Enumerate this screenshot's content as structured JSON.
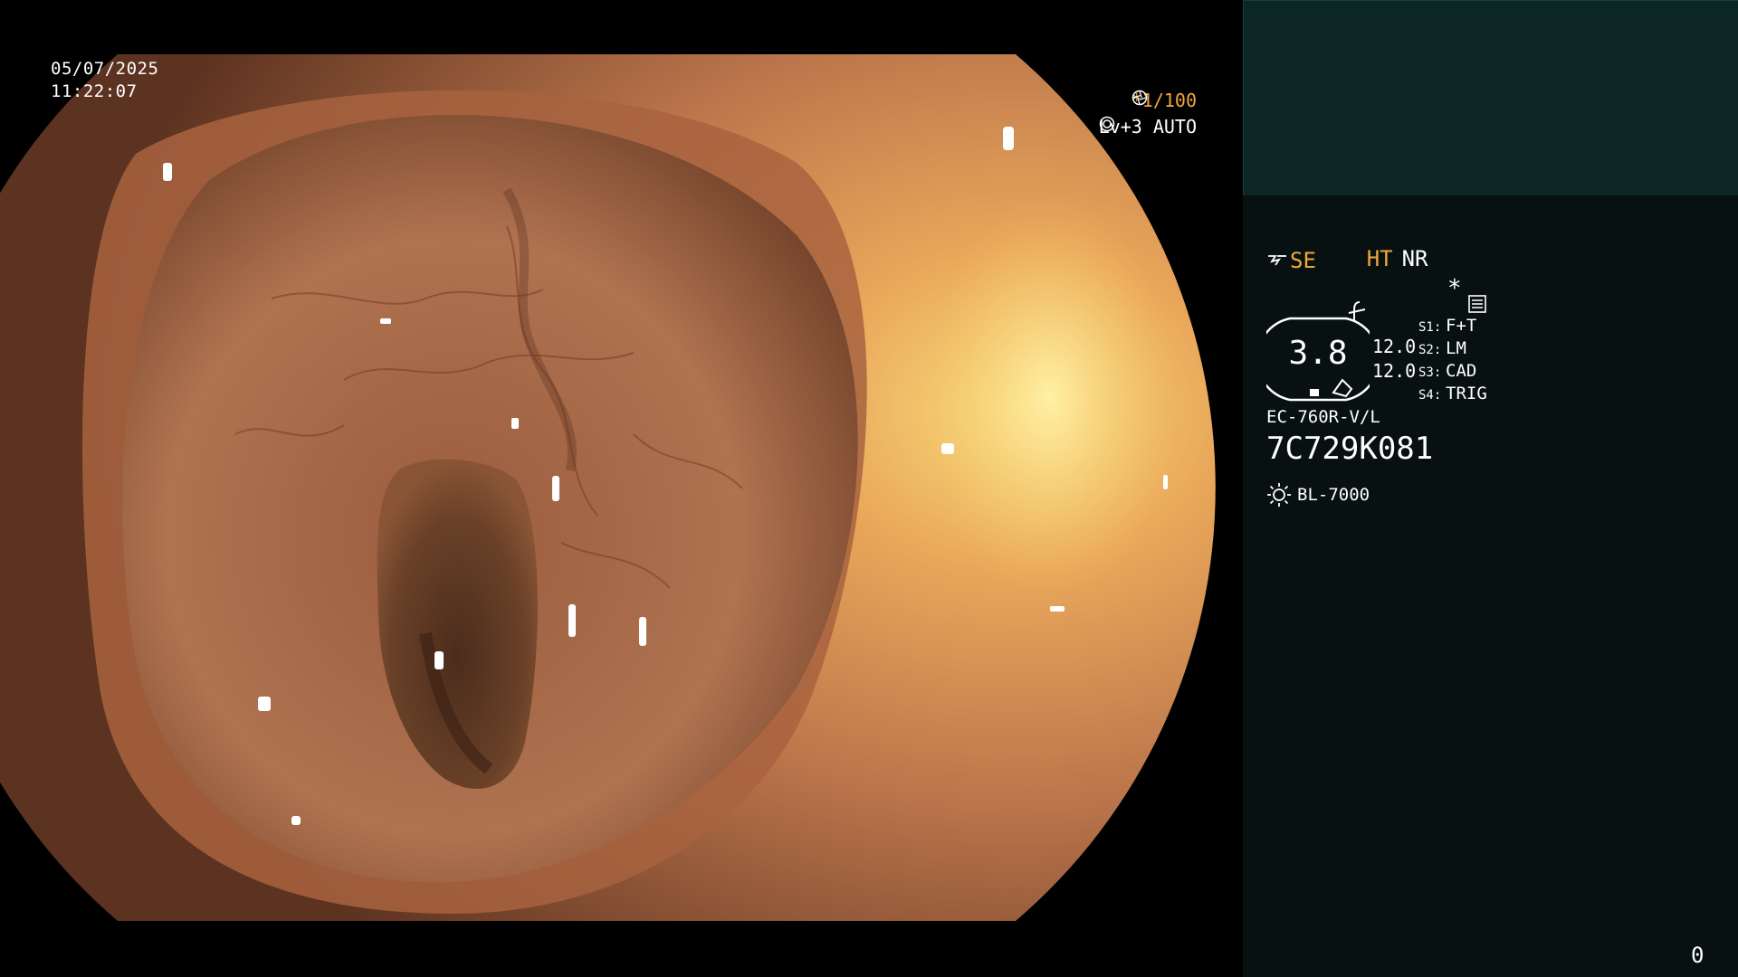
{
  "overlay": {
    "date": "05/07/2025",
    "time": "11:22:07",
    "shutter": "*1/100",
    "shutter_icon": "aperture-icon",
    "iris": "Lv+3 AUTO",
    "iris_icon": "iris-mode-icon"
  },
  "panel": {
    "mode_ht": "HT",
    "mode_nr": "NR",
    "mode_se": "SE",
    "se_icon": "structure-enhance-icon",
    "fx_icon": "color-mode-icon",
    "record_icon": "record-list-icon",
    "star": "*",
    "gauge_value": "3.8",
    "value_a": "12.0",
    "value_b": "12.0",
    "switches": [
      {
        "key": "S1:",
        "label": "F+T"
      },
      {
        "key": "S2:",
        "label": "LM"
      },
      {
        "key": "S3:",
        "label": "CAD"
      },
      {
        "key": "S4:",
        "label": "TRIG"
      }
    ],
    "scope_model": "EC-760R-V/L",
    "scope_serial": "7C729K081",
    "light_icon": "light-source-icon",
    "light_source": "BL-7000",
    "counter": "0"
  },
  "colors": {
    "accent_orange": "#f2a63a",
    "panel_top": "#0c2626",
    "panel_bg": "#071111",
    "text": "#ffffff"
  }
}
